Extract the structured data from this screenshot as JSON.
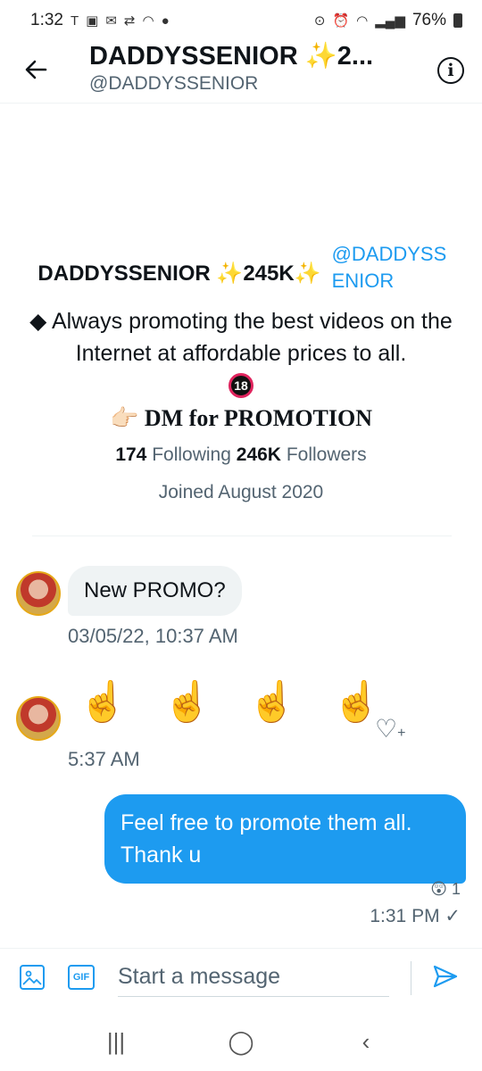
{
  "status_bar": {
    "time": "1:32",
    "left_icons": [
      "tmobile-icon",
      "camera-icon",
      "mail-icon",
      "retweet-icon",
      "wifi-calling-icon",
      "location-icon"
    ],
    "battery": "76%"
  },
  "header": {
    "title": "DADDYSSENIOR ✨2...",
    "handle": "@DADDYSSENIOR",
    "info_symbol": "i"
  },
  "profile": {
    "name": "DADDYSSENIOR ✨245K✨",
    "handle": "@DADDYSSENIOR",
    "bio_line1": "◆ Always promoting the best videos on the Internet at affordable prices to all.",
    "badge_18": "18",
    "dm_line": "👉🏻 DM for PROMOTION",
    "following_count": "174",
    "following_label": "Following",
    "followers_count": "246K",
    "followers_label": "Followers",
    "joined": "Joined August 2020"
  },
  "messages": {
    "incoming_1": {
      "text": "New PROMO?",
      "time": "03/05/22, 10:37 AM"
    },
    "incoming_2": {
      "emojis": [
        "☝️",
        "☝️",
        "☝️",
        "☝️"
      ],
      "time": "5:37 AM"
    },
    "outgoing_1": {
      "text": "Feel free to promote them all. Thank u",
      "reaction": "😲 1",
      "time": "1:31 PM ✓"
    }
  },
  "composer": {
    "placeholder": "Start a message",
    "gif_label": "GIF"
  },
  "navbar": {
    "recents": "|||",
    "home": "◯",
    "back": "‹"
  },
  "colors": {
    "accent": "#1d9bf0",
    "secondary_text": "#536471"
  }
}
